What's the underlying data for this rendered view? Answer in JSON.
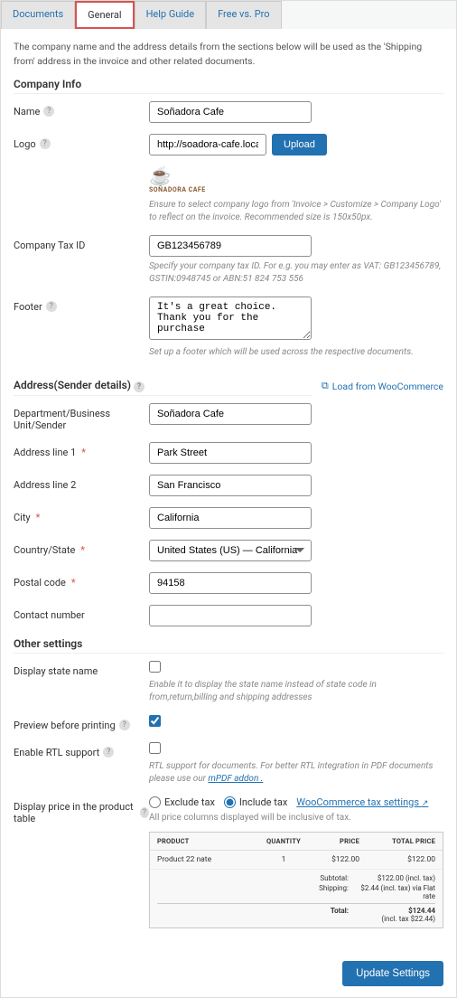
{
  "tabs": {
    "documents": "Documents",
    "general": "General",
    "help": "Help Guide",
    "free_pro": "Free vs. Pro"
  },
  "intro": "The company name and the address details from the sections below will be used as the 'Shipping from' address in the invoice and other related documents.",
  "sections": {
    "company": "Company Info",
    "address": "Address(Sender details)",
    "other": "Other settings"
  },
  "load_link": "Load from WooCommerce",
  "company": {
    "name_label": "Name",
    "name_value": "Soñadora Cafe",
    "logo_label": "Logo",
    "logo_value": "http://soadora-cafe.local/wp",
    "upload_btn": "Upload",
    "logo_caption": "SOÑADORA CAFE",
    "logo_hint": "Ensure to select company logo from 'Invoice > Customize > Company Logo' to reflect on the invoice. Recommended size is 150x50px.",
    "tax_label": "Company Tax ID",
    "tax_value": "GB123456789",
    "tax_hint": "Specify your company tax ID. For e.g. you may enter as VAT: GB123456789, GSTIN:0948745 or ABN:51 824 753 556",
    "footer_label": "Footer",
    "footer_value": "It's a great choice. Thank you for the purchase",
    "footer_hint": "Set up a footer which will be used across the respective documents."
  },
  "address": {
    "dept_label": "Department/Business Unit/Sender",
    "dept_value": "Soñadora Cafe",
    "line1_label": "Address line 1",
    "line1_value": "Park Street",
    "line2_label": "Address line 2",
    "line2_value": "San Francisco",
    "city_label": "City",
    "city_value": "California",
    "country_label": "Country/State",
    "country_value": "United States (US) — California",
    "postal_label": "Postal code",
    "postal_value": "94158",
    "contact_label": "Contact number",
    "contact_value": ""
  },
  "other": {
    "state_label": "Display state name",
    "state_hint": "Enable it to display the state name instead of state code in from,return,billing and shipping addresses",
    "preview_label": "Preview before printing",
    "rtl_label": "Enable RTL support",
    "rtl_hint_pre": "RTL support for documents. For better RTL integration in PDF documents please use our ",
    "rtl_hint_link": "mPDF addon .",
    "price_label": "Display price in the product table",
    "radio_exclude": "Exclude tax",
    "radio_include": "Include tax",
    "tax_settings_link": "WooCommerce tax settings",
    "price_hint": "All price columns displayed will be inclusive of tax."
  },
  "price_table": {
    "h_product": "PRODUCT",
    "h_qty": "QUANTITY",
    "h_price": "PRICE",
    "h_total": "TOTAL PRICE",
    "row_product": "Product 22 nate",
    "row_qty": "1",
    "row_price": "$122.00",
    "row_total": "$122.00",
    "sub_label": "Subtotal:",
    "sub_val": "$122.00 (incl. tax)",
    "ship_label": "Shipping:",
    "ship_val": "$2.44 (incl. tax) via Flat rate",
    "total_label": "Total:",
    "total_val": "$124.44",
    "total_sub": "(incl. tax $22.44)"
  },
  "update_btn": "Update Settings"
}
